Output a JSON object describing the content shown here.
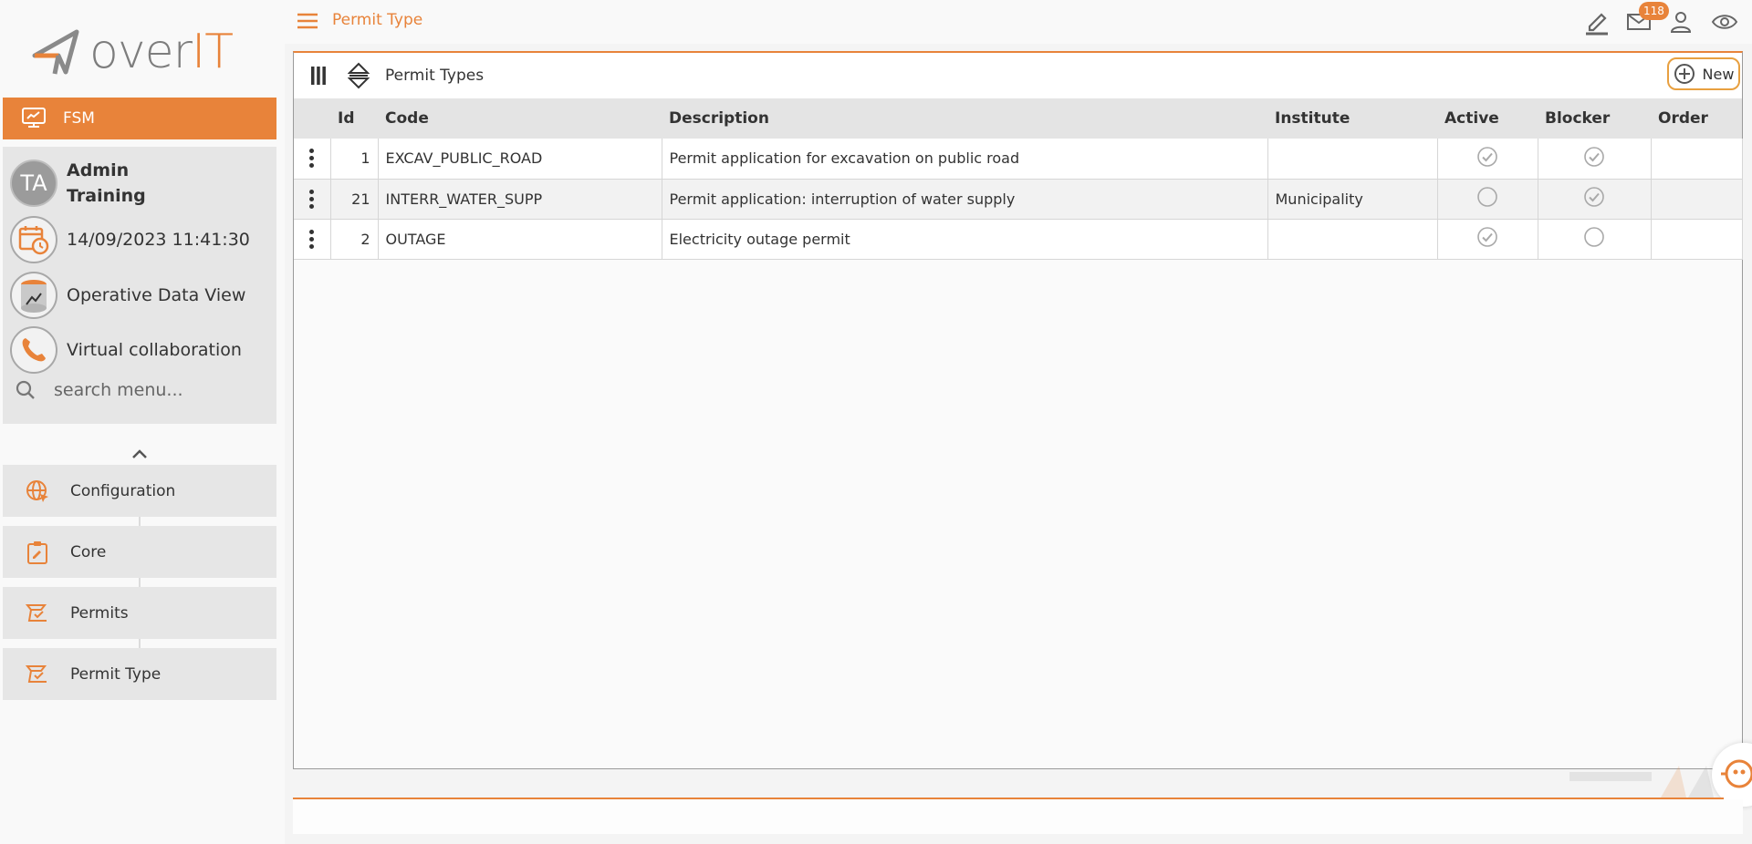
{
  "logo": {
    "text_gray": "over",
    "text_orange": "IT"
  },
  "module": {
    "label": "FSM"
  },
  "user": {
    "initials": "TA",
    "first_line": "Admin",
    "second_line": "Training",
    "datetime": "14/09/2023 11:41:30",
    "data_view": "Operative Data View",
    "collaboration": "Virtual collaboration"
  },
  "search": {
    "placeholder": "search menu..."
  },
  "menu": {
    "items": [
      {
        "label": "Configuration",
        "icon": "globe-cursor-icon"
      },
      {
        "label": "Core",
        "icon": "clipboard-edit-icon"
      },
      {
        "label": "Permits",
        "icon": "permit-icon"
      },
      {
        "label": "Permit Type",
        "icon": "permit-icon"
      }
    ]
  },
  "header": {
    "title": "Permit Type",
    "mail_count": "118"
  },
  "grid": {
    "title": "Permit Types",
    "new_label": "New",
    "columns": [
      "Id",
      "Code",
      "Description",
      "Institute",
      "Active",
      "Blocker",
      "Order"
    ],
    "rows": [
      {
        "id": "1",
        "code": "EXCAV_PUBLIC_ROAD",
        "description": "Permit application for excavation on public road",
        "institute": "",
        "active": true,
        "blocker": true,
        "order": ""
      },
      {
        "id": "21",
        "code": "INTERR_WATER_SUPP",
        "description": "Permit application: interruption of water supply",
        "institute": "Municipality",
        "active": false,
        "blocker": true,
        "order": ""
      },
      {
        "id": "2",
        "code": "OUTAGE",
        "description": "Electricity outage permit",
        "institute": "",
        "active": true,
        "blocker": false,
        "order": ""
      }
    ]
  },
  "colors": {
    "accent": "#e8833a",
    "panel": "#e6e6e6"
  }
}
